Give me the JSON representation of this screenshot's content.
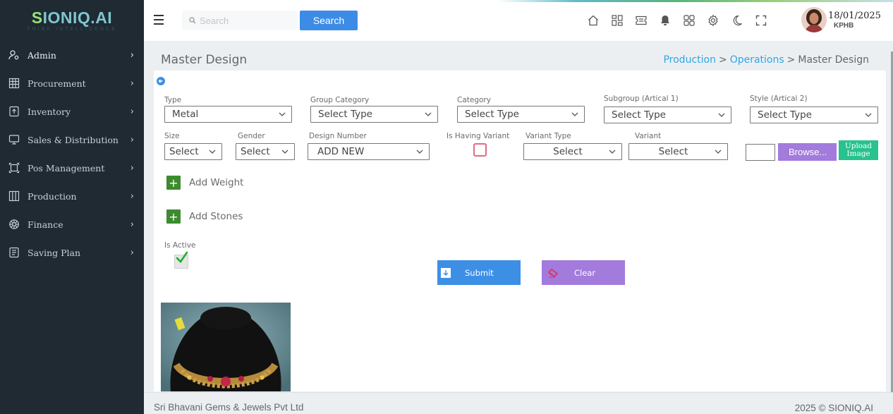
{
  "logo": {
    "brand": "SIONIQ.AI",
    "brand_first": "S",
    "brand_rest": "IONIQ.AI",
    "tagline": "THINK INTELLIGENCE"
  },
  "sidebar": {
    "items": [
      {
        "label": "Admin",
        "icon": "user-cog-icon"
      },
      {
        "label": "Procurement",
        "icon": "grid-table-icon"
      },
      {
        "label": "Inventory",
        "icon": "inventory-box-icon"
      },
      {
        "label": "Sales & Distribution",
        "icon": "monitor-icon"
      },
      {
        "label": "Pos Management",
        "icon": "pos-frame-icon"
      },
      {
        "label": "Production",
        "icon": "columns-icon"
      },
      {
        "label": "Finance",
        "icon": "gear-flower-icon"
      },
      {
        "label": "Saving Plan",
        "icon": "document-list-icon"
      }
    ]
  },
  "topbar": {
    "search_placeholder": "Search",
    "search_button": "Search",
    "icons": [
      "home-icon",
      "apps-grid-icon",
      "ticket-icon",
      "bell-icon",
      "dashboard-grid-icon",
      "settings-icon",
      "moon-icon",
      "fullscreen-icon"
    ],
    "date": "18/01/2025",
    "location": "KPHB"
  },
  "page": {
    "title": "Master Design",
    "breadcrumb": [
      "Production",
      "Operations",
      "Master Design"
    ]
  },
  "form": {
    "type": {
      "label": "Type",
      "value": "Metal"
    },
    "group_category": {
      "label": "Group Category",
      "value": "Select Type"
    },
    "category": {
      "label": "Category",
      "value": "Select Type"
    },
    "subgroup": {
      "label": "Subgroup (Artical 1)",
      "value": "Select Type"
    },
    "style": {
      "label": "Style (Artical 2)",
      "value": "Select Type"
    },
    "size": {
      "label": "Size",
      "value": "Select"
    },
    "gender": {
      "label": "Gender",
      "value": "Select"
    },
    "design_number": {
      "label": "Design Number",
      "value": "ADD NEW"
    },
    "is_having_variant": {
      "label": "Is Having Variant",
      "checked": false
    },
    "variant_type": {
      "label": "Variant Type",
      "value": "Select"
    },
    "variant": {
      "label": "Variant",
      "value": "Select"
    },
    "browse_label": "Browse...",
    "upload_label_1": "Upload",
    "upload_label_2": "Image",
    "add_weight": "Add Weight",
    "add_stones": "Add Stones",
    "is_active": {
      "label": "Is Active",
      "checked": true
    },
    "submit": "Submit",
    "clear": "Clear"
  },
  "footer": {
    "company": "Sri Bhavani Gems & Jewels Pvt Ltd",
    "copyright": "2025 © SIONIQ.AI"
  },
  "colors": {
    "sidebar_bg": "#1f2a33",
    "primary_blue": "#3d8fe6",
    "purple": "#a27bdc",
    "green": "#27c28d",
    "dark_green": "#3c8b2e",
    "link_blue": "#2ea6e8"
  }
}
